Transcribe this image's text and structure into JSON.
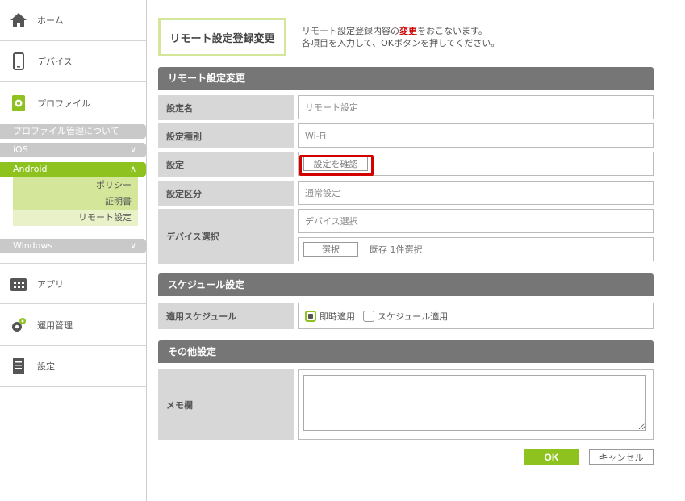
{
  "sidebar": {
    "home": "ホーム",
    "device": "デバイス",
    "profile": "プロファイル",
    "profile_about": "プロファイル管理について",
    "ios": "iOS",
    "android": "Android",
    "android_items": [
      "ポリシー",
      "証明書",
      "リモート設定"
    ],
    "windows": "Windows",
    "app": "アプリ",
    "operation": "運用管理",
    "settings": "設定"
  },
  "header": {
    "title": "リモート設定登録変更",
    "desc_prefix": "リモート設定登録内容の",
    "desc_highlight": "変更",
    "desc_suffix": "をおこないます。",
    "desc_line2": "各項目を入力して、OKボタンを押してください。"
  },
  "remote": {
    "section": "リモート設定変更",
    "name_label": "設定名",
    "name_value": "リモート設定",
    "type_label": "設定種別",
    "type_value": "Wi-Fi",
    "setting_label": "設定",
    "confirm_button": "設定を確認",
    "category_label": "設定区分",
    "category_value": "通常設定",
    "device_label": "デバイス選択",
    "device_value": "デバイス選択",
    "select_button": "選択",
    "selected_count": "既存 1件選択"
  },
  "schedule": {
    "section": "スケジュール設定",
    "label": "適用スケジュール",
    "opt_immediate": "即時適用",
    "opt_schedule": "スケジュール適用"
  },
  "other": {
    "section": "その他設定",
    "memo_label": "メモ欄",
    "memo_value": ""
  },
  "actions": {
    "ok": "OK",
    "cancel": "キャンセル"
  },
  "colors": {
    "accent": "#8dc21f",
    "section_bg": "#767676",
    "highlight": "#d40000"
  }
}
